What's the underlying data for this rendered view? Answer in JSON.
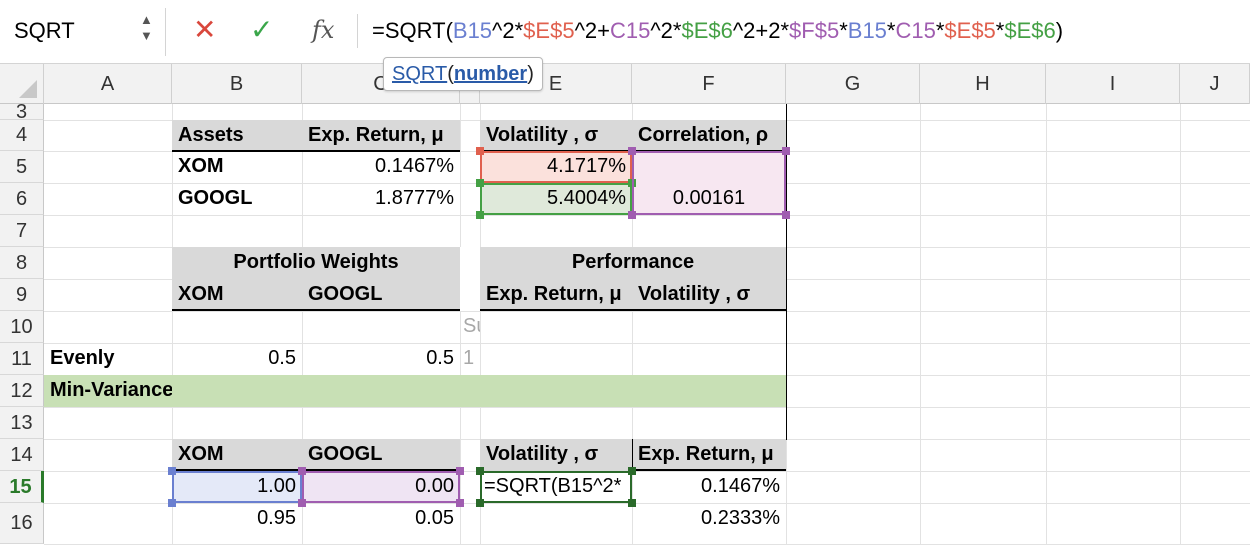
{
  "formula_bar": {
    "name_box": "SQRT",
    "cancel_icon": "✕",
    "enter_icon": "✓",
    "fx_label": "fx",
    "formula_parts": [
      {
        "t": "=SQRT(",
        "c": ""
      },
      {
        "t": "B15",
        "c": "r-blue"
      },
      {
        "t": "^2*",
        "c": ""
      },
      {
        "t": "$E$5",
        "c": "r-red"
      },
      {
        "t": "^2+",
        "c": ""
      },
      {
        "t": "C15",
        "c": "r-purple"
      },
      {
        "t": "^2*",
        "c": ""
      },
      {
        "t": "$E$6",
        "c": "r-green"
      },
      {
        "t": "^2+2*",
        "c": ""
      },
      {
        "t": "$F$5",
        "c": "r-purple"
      },
      {
        "t": "*",
        "c": ""
      },
      {
        "t": "B15",
        "c": "r-blue"
      },
      {
        "t": "*",
        "c": ""
      },
      {
        "t": "C15",
        "c": "r-purple"
      },
      {
        "t": "*",
        "c": ""
      },
      {
        "t": "$E$5",
        "c": "r-red"
      },
      {
        "t": "*",
        "c": ""
      },
      {
        "t": "$E$6",
        "c": "r-green"
      },
      {
        "t": ")",
        "c": ""
      }
    ]
  },
  "tooltip": {
    "fn": "SQRT",
    "open": "(",
    "arg": "number",
    "close": ")"
  },
  "columns": [
    "A",
    "B",
    "C",
    "D",
    "E",
    "F",
    "G",
    "H",
    "I",
    "J"
  ],
  "rows": [
    "3",
    "4",
    "5",
    "6",
    "7",
    "8",
    "9",
    "10",
    "11",
    "12",
    "13",
    "14",
    "15",
    "16"
  ],
  "active_row": "15",
  "colors": {
    "red_ref": "#e0604e",
    "green_ref": "#44a044",
    "blue_ref": "#6a7fd0",
    "purple_ref": "#a05db0",
    "header_fill": "#d9d9d9",
    "min_variance_fill": "#c8e0b5"
  },
  "cells": {
    "B4": "Assets",
    "C4": "Exp. Return, μ",
    "E4": "Volatility , σ",
    "F4": "Correlation, ρ",
    "B5": "XOM",
    "C5": "0.1467%",
    "E5": "4.1717%",
    "B6": "GOOGL",
    "C6": "1.8777%",
    "E6": "5.4004%",
    "F6": "0.00161",
    "B8": "Portfolio Weights",
    "E8": "Performance",
    "B9": "XOM",
    "C9": "GOOGL",
    "E9": "Exp. Return, μ",
    "F9": "Volatility , σ",
    "D10": "Sum",
    "A11": "Evenly",
    "B11": "0.5",
    "C11": "0.5",
    "D11": "1",
    "A12": "Min-Variance",
    "B14": "XOM",
    "C14": "GOOGL",
    "E14": "Volatility , σ",
    "F14": "Exp. Return, μ",
    "B15": "1.00",
    "C15": "0.00",
    "E15": "=SQRT(B15^2*",
    "F15": "0.1467%",
    "B16": "0.95",
    "C16": "0.05",
    "F16": "0.2333%"
  }
}
